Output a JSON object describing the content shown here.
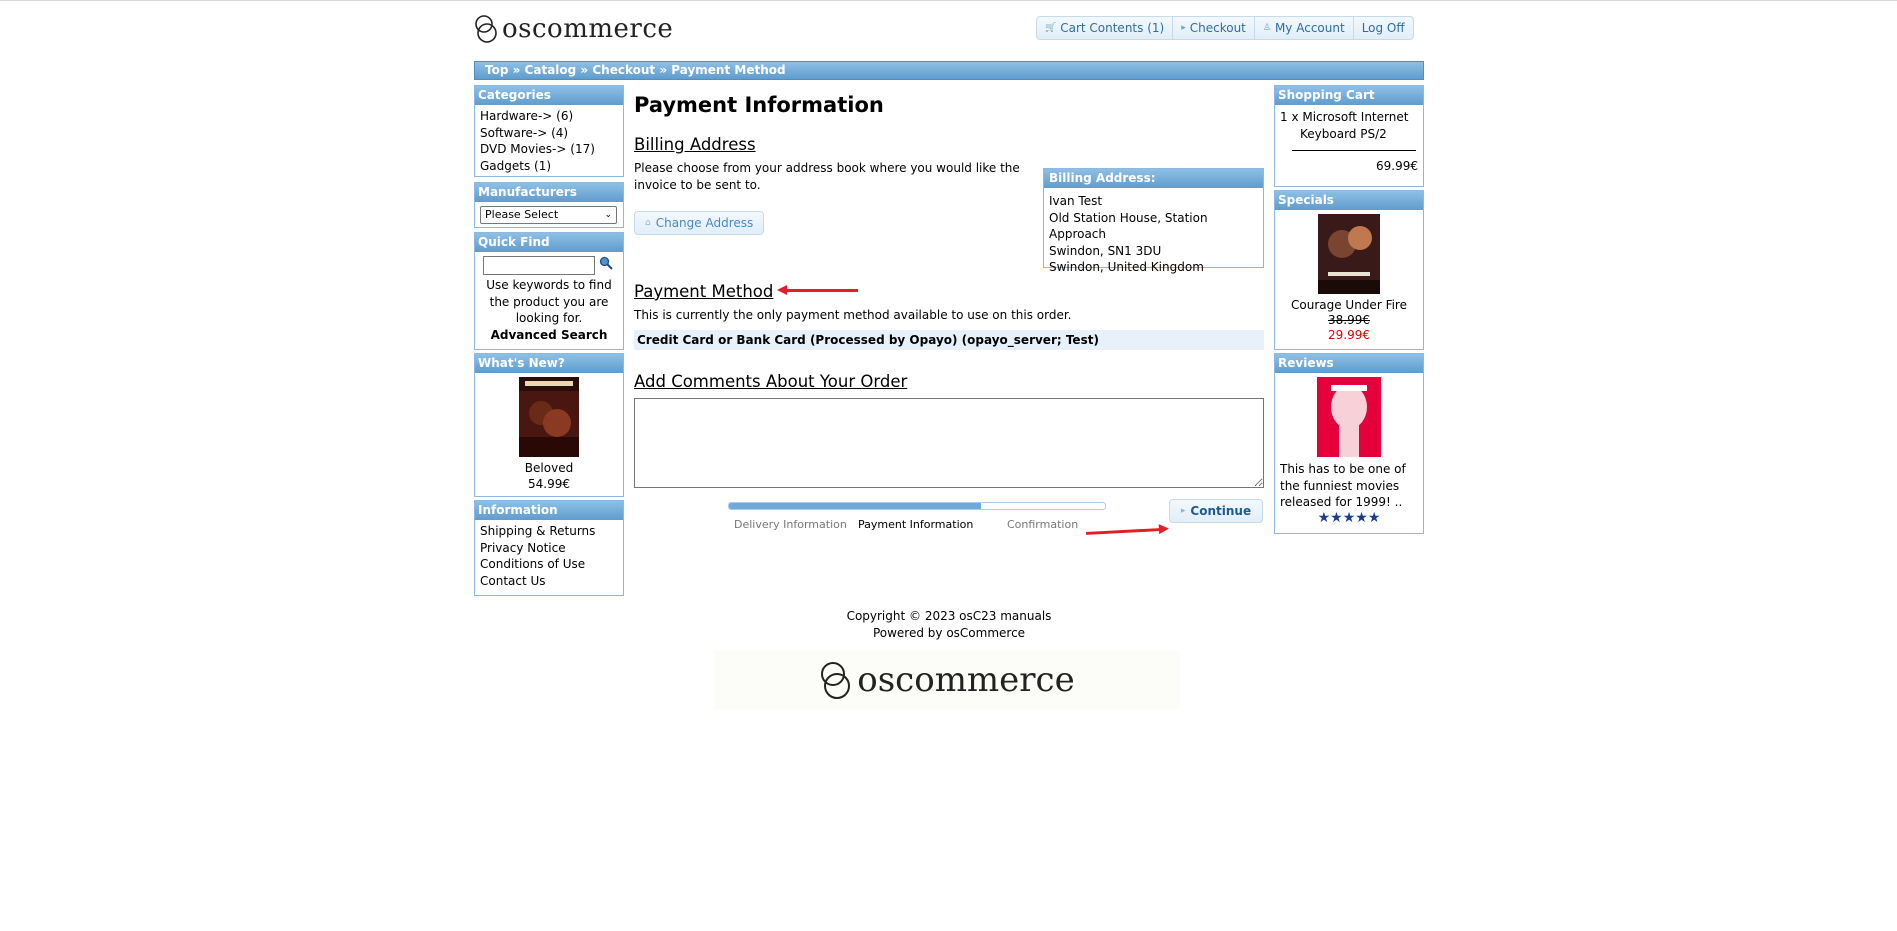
{
  "header": {
    "logo_text": "oscommerce",
    "nav": [
      {
        "label": "Cart Contents (1)",
        "icon": "cart-icon"
      },
      {
        "label": "Checkout",
        "icon": "triangle-right-icon"
      },
      {
        "label": "My Account",
        "icon": "person-icon"
      },
      {
        "label": "Log Off",
        "icon": ""
      }
    ]
  },
  "breadcrumb": [
    "Top",
    "Catalog",
    "Checkout",
    "Payment Method"
  ],
  "breadcrumb_sep": " » ",
  "left": {
    "categories": {
      "title": "Categories",
      "items": [
        {
          "name": "Hardware->",
          "count": " (6)"
        },
        {
          "name": "Software->",
          "count": " (4)"
        },
        {
          "name": "DVD Movies->",
          "count": " (17)"
        },
        {
          "name": "Gadgets",
          "count": " (1)"
        }
      ]
    },
    "manufacturers": {
      "title": "Manufacturers",
      "selected": "Please Select"
    },
    "quick_find": {
      "title": "Quick Find",
      "help": "Use keywords to find the product you are looking for.",
      "advanced": "Advanced Search"
    },
    "whats_new": {
      "title": "What's New?",
      "product": "Beloved",
      "price": "54.99€"
    },
    "information": {
      "title": "Information",
      "links": [
        "Shipping & Returns",
        "Privacy Notice",
        "Conditions of Use",
        "Contact Us"
      ]
    }
  },
  "main": {
    "title": "Payment Information",
    "billing": {
      "heading": "Billing Address",
      "text": "Please choose from your address book where you would like the invoice to be sent to.",
      "change_button": "Change Address",
      "box_title": "Billing Address:",
      "address": [
        "Ivan Test",
        "Old Station House, Station Approach",
        "Swindon, SN1 3DU",
        "Swindon, United Kingdom"
      ]
    },
    "payment": {
      "heading": "Payment Method",
      "text": "This is currently the only payment method available to use on this order.",
      "method": "Credit Card or Bank Card (Processed by Opayo) (opayo_server; Test)"
    },
    "comments": {
      "heading": "Add Comments About Your Order",
      "value": ""
    },
    "progress": {
      "steps": [
        "Delivery Information",
        "Payment Information",
        "Confirmation"
      ],
      "active": 1,
      "fraction": 0.67
    },
    "continue_button": "Continue"
  },
  "right": {
    "cart": {
      "title": "Shopping Cart",
      "item": "1 x Microsoft Internet Keyboard PS/2",
      "total": "69.99€"
    },
    "specials": {
      "title": "Specials",
      "product": "Courage Under Fire",
      "old_price": "38.99€",
      "new_price": "29.99€"
    },
    "reviews": {
      "title": "Reviews",
      "text": "This has to be one of the funniest movies released for 1999! ..",
      "stars": "★★★★★"
    }
  },
  "footer": {
    "copyright": "Copyright © 2023 osC23 manuals",
    "powered": "Powered by osCommerce",
    "logo_text": "oscommerce"
  }
}
